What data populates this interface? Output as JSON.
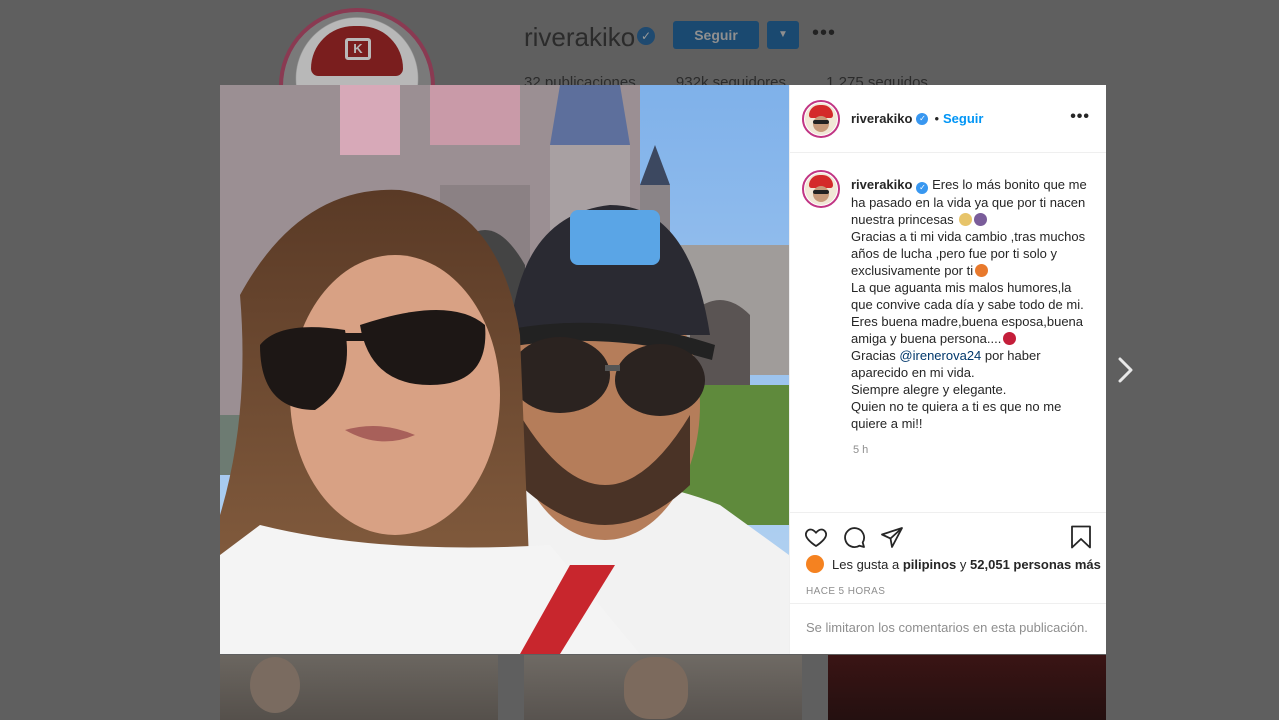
{
  "profile": {
    "username": "riverakiko",
    "follow_label": "Seguir",
    "dropdown_icon": "chevron-down-icon",
    "more_icon": "more-options-icon",
    "stats": {
      "posts": "32 publicaciones",
      "followers": "932k seguidores",
      "following": "1.275 seguidos"
    }
  },
  "post": {
    "header": {
      "username": "riverakiko",
      "separator": "•",
      "follow_label": "Seguir"
    },
    "caption": {
      "username": "riverakiko",
      "lines": [
        "Eres lo más bonito que me ha pasado en la vida ya que por ti nacen nuestra princesas",
        "Gracias a ti mi vida cambio ,tras muchos años de lucha ,pero fue por ti solo y exclusivamente por ti",
        "La que aguanta mis malos humores,la que convive cada día y sabe todo de mi.",
        "Eres buena madre,buena esposa,buena amiga y buena persona....",
        "Gracias",
        "@irenerova24",
        "por haber aparecido en mi vida.",
        "Siempre alegre y elegante.",
        "Quien no te quiera a ti es que no me quiere a mi!!"
      ],
      "time": "5 h"
    },
    "likes": {
      "prefix": "Les gusta a",
      "user": "pilipinos",
      "joiner": "y",
      "others": "52,051 personas más"
    },
    "ago": "HACE 5 HORAS",
    "comments_disabled": "Se limitaron los comentarios en esta publicación."
  },
  "colors": {
    "accent": "#0095f6",
    "verified": "#3897f0",
    "overlay": "#5f5f5f",
    "ring": "#c13584"
  },
  "icons": [
    "verified-icon",
    "heart-icon",
    "comment-icon",
    "share-icon",
    "bookmark-icon",
    "next-arrow-icon"
  ]
}
